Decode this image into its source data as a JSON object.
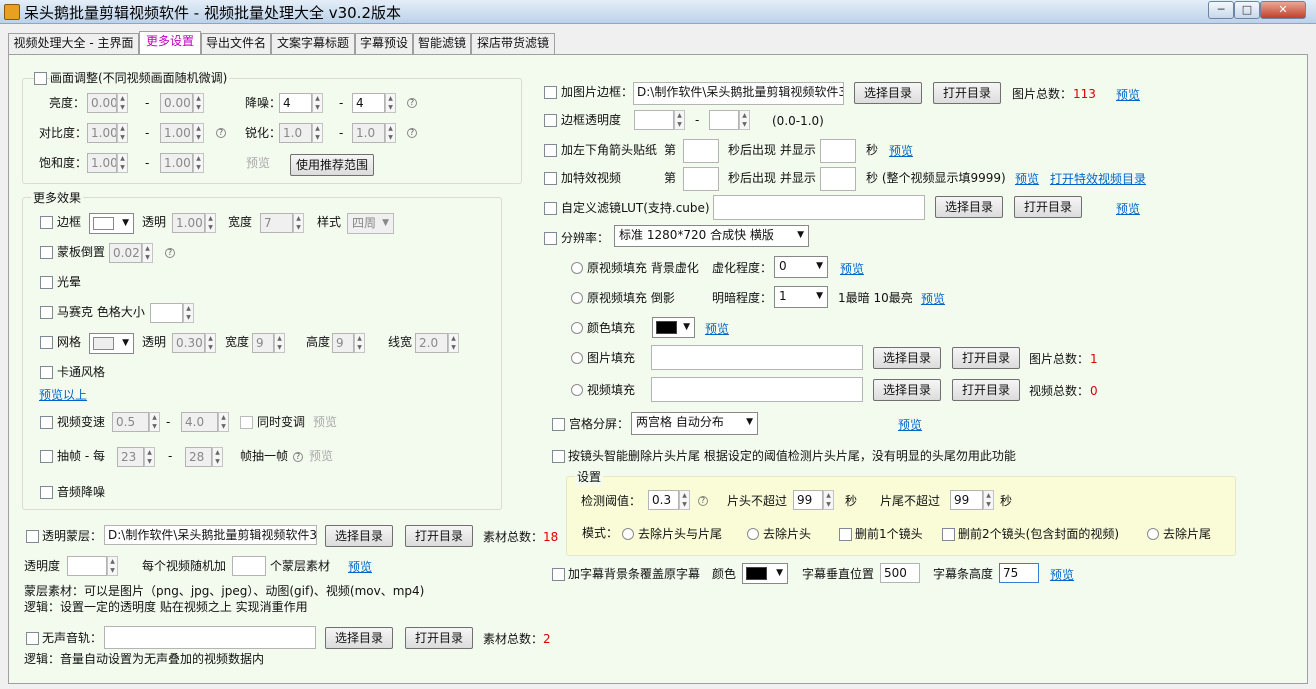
{
  "window": {
    "title": "呆头鹅批量剪辑视频软件 -  视频批量处理大全  v30.2版本",
    "min_label": "─",
    "max_label": "□",
    "close_label": "✕"
  },
  "tabs": [
    "视频处理大全 - 主界面",
    "更多设置",
    "导出文件名",
    "文案字幕标题",
    "字幕预设",
    "智能滤镜",
    "探店带货滤镜"
  ],
  "common": {
    "preview": "预览",
    "dash": "-",
    "choose_dir": "选择目录",
    "open_dir": "打开目录",
    "help": "?"
  },
  "picture_adjust": {
    "title": "画面调整(不同视频画面随机微调)",
    "brightness": {
      "label": "亮度：",
      "min": "0.00",
      "max": "0.00"
    },
    "denoise": {
      "label": "降噪：",
      "min": "4",
      "max": "4"
    },
    "contrast": {
      "label": "对比度：",
      "min": "1.00",
      "max": "1.00"
    },
    "sharpen": {
      "label": "锐化：",
      "min": "1.0",
      "max": "1.0"
    },
    "saturation": {
      "label": "饱和度：",
      "min": "1.00",
      "max": "1.00"
    },
    "recommend_button": "使用推荐范围"
  },
  "more_effects": {
    "title": "更多效果",
    "border": {
      "label": "边框",
      "opacity_label": "透明",
      "opacity": "1.00",
      "width_label": "宽度",
      "width": "7",
      "style_label": "样式",
      "style": "四周"
    },
    "mask_mirror": {
      "label": "蒙板倒置",
      "value": "0.02"
    },
    "halo": {
      "label": "光晕"
    },
    "mosaic": {
      "label": "马赛克 色格大小",
      "value": ""
    },
    "grid": {
      "label": "网格",
      "opacity_label": "透明",
      "opacity": "0.30",
      "width_label": "宽度",
      "width": "9",
      "height_label": "高度",
      "height": "9",
      "line_label": "线宽",
      "line": "2.0"
    },
    "cartoon": {
      "label": "卡通风格"
    },
    "preview_above": "预览以上",
    "speed": {
      "label": "视频变速",
      "min": "0.5",
      "max": "4.0",
      "pitch_label": "同时变调"
    },
    "frame_drop": {
      "label": "抽帧 - 每",
      "min": "23",
      "max": "28",
      "suffix": "帧抽一帧"
    },
    "audio_denoise": {
      "label": "音频降噪"
    }
  },
  "overlay": {
    "label": "透明蒙层：",
    "path": "D:\\制作软件\\呆头鹅批量剪辑视频软件3",
    "total_label": "素材总数：",
    "total": "18",
    "opacity_label": "透明度",
    "per_video_label": "每个视频随机加",
    "count_suffix": "个蒙层素材",
    "note1": "蒙层素材：可以是图片（png、jpg、jpeg）、动图(gif)、视频(mov、mp4)",
    "note2": "逻辑：设置一定的透明度 贴在视频之上 实现消重作用"
  },
  "silent": {
    "label": "无声音轨：",
    "path": "",
    "total_label": "素材总数：",
    "total": "2",
    "note": "逻辑：音量自动设置为无声叠加的视频数据内"
  },
  "right": {
    "image_border": {
      "label": "加图片边框：",
      "path": "D:\\制作软件\\呆头鹅批量剪辑视频软件3",
      "total_label": "图片总数：",
      "total": "113"
    },
    "border_opacity": {
      "label": "边框透明度",
      "min": "",
      "max": "",
      "range": "(0.0-1.0)"
    },
    "arrow_sticker": {
      "label": "加左下角箭头贴纸",
      "nth": "第",
      "after": "秒后出现 并显示",
      "sec": "秒"
    },
    "effect_video": {
      "label": "加特效视频",
      "nth": "第",
      "after": "秒后出现 并显示",
      "note": "秒 (整个视频显示填9999)",
      "open_link": "打开特效视频目录"
    },
    "lut": {
      "label": "自定义滤镜LUT(支持.cube)",
      "path": ""
    },
    "resolution": {
      "label": "分辨率：",
      "value": "标准 1280*720 合成快 横版"
    },
    "fill_blur": {
      "label": "原视频填充 背景虚化",
      "degree_label": "虚化程度：",
      "degree": "0"
    },
    "fill_shadow": {
      "label": "原视频填充 倒影",
      "dark_label": "明暗程度：",
      "dark": "1",
      "hint": "1最暗 10最亮"
    },
    "fill_color": {
      "label": "颜色填充",
      "color": "#000000"
    },
    "fill_image": {
      "label": "图片填充",
      "total_label": "图片总数：",
      "total": "1"
    },
    "fill_video": {
      "label": "视频填充",
      "total_label": "视频总数：",
      "total": "0"
    },
    "grid_split": {
      "label": "宫格分屏：",
      "value": "两宫格 自动分布"
    },
    "smart_trim": {
      "label": "按镜头智能删除片头片尾   根据设定的阈值检测片头片尾，没有明显的头尾勿用此功能"
    },
    "settings": {
      "title": "设置",
      "threshold_label": "检测阈值：",
      "threshold": "0.3",
      "head_label": "片头不超过",
      "head": "99",
      "tail_label": "片尾不超过",
      "tail": "99",
      "sec": "秒",
      "mode_label": "模式：",
      "modes": [
        "去除片头与片尾",
        "去除片头",
        "删前1个镜头",
        "删前2个镜头(包含封面的视频)",
        "去除片尾"
      ]
    },
    "subtitle_bar": {
      "label": "加字幕背景条覆盖原字幕",
      "color_label": "颜色",
      "color": "#000000",
      "vpos_label": "字幕垂直位置",
      "vpos": "500",
      "height_label": "字幕条高度",
      "height": "75"
    }
  }
}
